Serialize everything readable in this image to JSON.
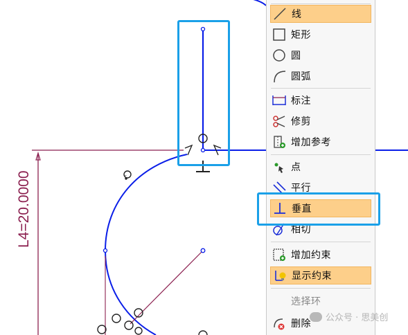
{
  "canvas": {
    "dimension_label": "L4=20.0000",
    "colors": {
      "geometry": "#0a1ee8",
      "dimension": "#8b1f4f",
      "callout": "#1aa0e8"
    }
  },
  "context_menu": {
    "items": [
      {
        "label": "线",
        "icon": "line-icon",
        "highlighted": true
      },
      {
        "label": "矩形",
        "icon": "rectangle-icon",
        "highlighted": false
      },
      {
        "label": "圆",
        "icon": "circle-icon",
        "highlighted": false
      },
      {
        "label": "圆弧",
        "icon": "arc-icon",
        "highlighted": false
      },
      {
        "label": "标注",
        "icon": "dimension-icon",
        "highlighted": false
      },
      {
        "label": "修剪",
        "icon": "trim-icon",
        "highlighted": false
      },
      {
        "label": "增加参考",
        "icon": "add-reference-icon",
        "highlighted": false
      },
      {
        "label": "点",
        "icon": "point-icon",
        "highlighted": false
      },
      {
        "label": "平行",
        "icon": "parallel-icon",
        "highlighted": false
      },
      {
        "label": "垂直",
        "icon": "perpendicular-icon",
        "highlighted": true
      },
      {
        "label": "相切",
        "icon": "tangent-icon",
        "highlighted": false
      },
      {
        "label": "增加约束",
        "icon": "add-constraint-icon",
        "highlighted": false
      },
      {
        "label": "显示约束",
        "icon": "show-constraints-icon",
        "highlighted": true
      },
      {
        "label": "选择环",
        "icon": "",
        "highlighted": false,
        "disabled": true
      },
      {
        "label": "删除",
        "icon": "delete-icon",
        "highlighted": false
      }
    ],
    "highlight_color": "#fdcf8a"
  },
  "watermark": {
    "text": "公众号 · 思美创"
  }
}
